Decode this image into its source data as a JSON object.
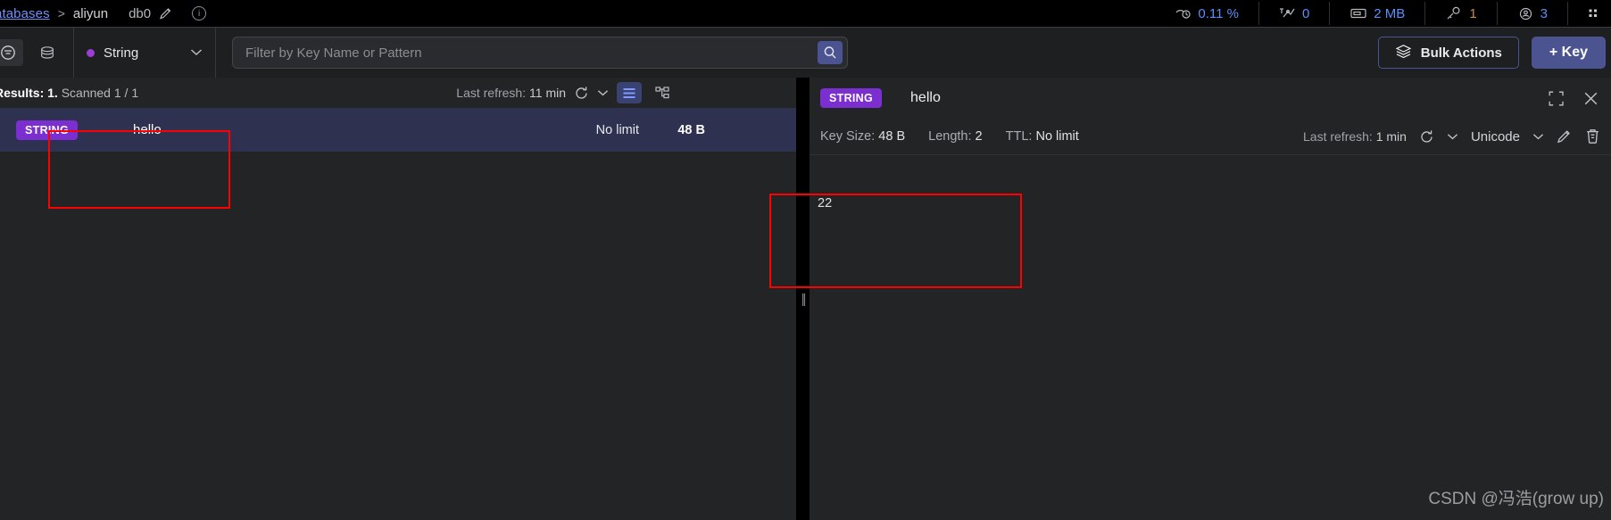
{
  "breadcrumb": {
    "databases_link": "atabases",
    "separator": ">",
    "connection_name": "aliyun",
    "database": "db0",
    "edit_icon": "pencil-icon",
    "info_icon": "info-icon",
    "info_badge": "i"
  },
  "metrics": [
    {
      "icon": "cpu-icon",
      "value": "0.11 %",
      "color": "#5b8ff9"
    },
    {
      "icon": "network-icon",
      "value": "0",
      "color": "#5b8ff9"
    },
    {
      "icon": "memory-icon",
      "value": "2 MB",
      "color": "#5b8ff9"
    },
    {
      "icon": "key-icon",
      "value": "1",
      "color": "#c98a4b"
    },
    {
      "icon": "clients-icon",
      "value": "3",
      "color": "#5b8ff9"
    }
  ],
  "toolbar": {
    "filter_icon": "filter-icon",
    "stack_icon": "database-stack-icon",
    "type_filter": {
      "label": "String",
      "dot_color": "#9b3fd4",
      "chevron": "chevron-down-icon"
    },
    "search": {
      "value": "",
      "placeholder": "Filter by Key Name or Pattern",
      "button_icon": "search-icon"
    },
    "bulk_actions_label": "Bulk Actions",
    "bulk_actions_icon": "layers-icon",
    "add_key_label": "+ Key"
  },
  "results": {
    "summary_prefix": "Results:",
    "summary_count": "1.",
    "summary_scanned": "Scanned 1 / 1",
    "last_refresh_label": "Last refresh:",
    "last_refresh_value": "11 min",
    "refresh_icon": "refresh-icon",
    "refresh_chevron": "chevron-down-icon",
    "view_list_icon": "list-view-icon",
    "view_tree_icon": "tree-view-icon"
  },
  "key_row": {
    "type": "STRING",
    "name": "hello",
    "ttl": "No limit",
    "size": "48 B"
  },
  "detail": {
    "type": "STRING",
    "name": "hello",
    "fullscreen_icon": "fullscreen-icon",
    "close_icon": "close-icon",
    "key_size_label": "Key Size:",
    "key_size_value": "48 B",
    "length_label": "Length:",
    "length_value": "2",
    "ttl_label": "TTL:",
    "ttl_value": "No limit",
    "last_refresh_label": "Last refresh:",
    "last_refresh_value": "1 min",
    "refresh_icon": "refresh-icon",
    "refresh_chevron": "chevron-down-icon",
    "encoding": "Unicode",
    "encoding_chevron": "chevron-down-icon",
    "edit_icon": "pencil-icon",
    "delete_icon": "trash-icon",
    "value": "22"
  },
  "splitter": {
    "grip": "||"
  },
  "watermark": "CSDN @冯浩(grow up)"
}
